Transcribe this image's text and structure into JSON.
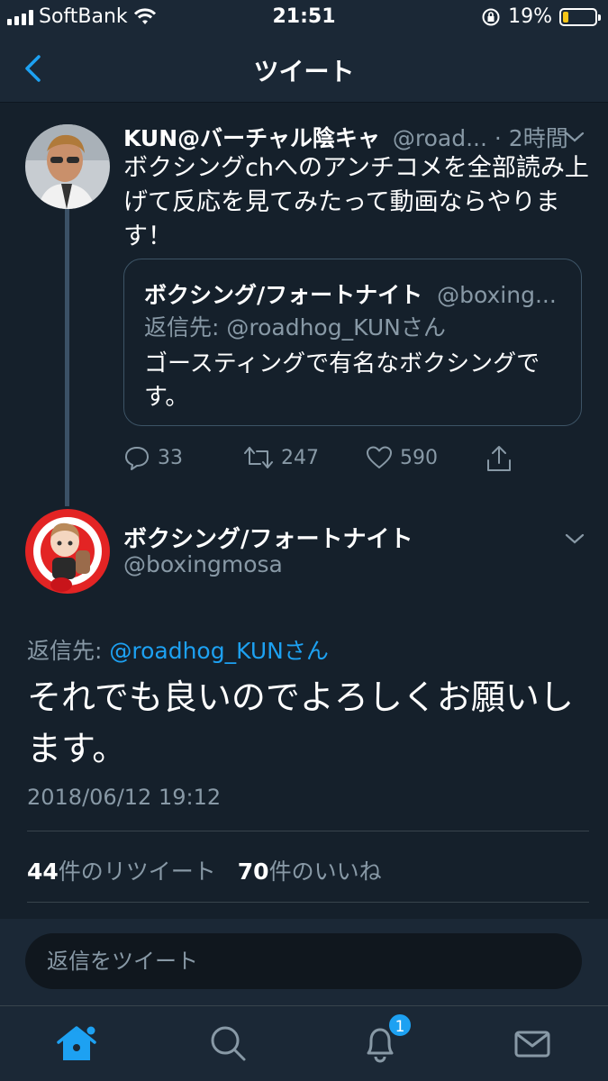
{
  "status_bar": {
    "carrier": "SoftBank",
    "time": "21:51",
    "battery_percent": "19%",
    "battery_level": 0.19,
    "icons": [
      "signal-icon",
      "wifi-icon",
      "rotation-lock-icon",
      "battery-icon"
    ]
  },
  "nav": {
    "title": "ツイート",
    "back_icon": "chevron-left-icon"
  },
  "tweet1": {
    "name": "KUN@バーチャル陰キャ",
    "handle": "@road...",
    "time": "· 2時間",
    "text": "ボクシングchへのアンチコメを全部読み上げて反応を見てみたって動画ならやります！",
    "quote": {
      "name": "ボクシング/フォートナイト",
      "handle": "@boxing...",
      "reply_to": "返信先: @roadhog_KUNさん",
      "text": "ゴースティングで有名なボクシングです。"
    },
    "actions": {
      "replies": "33",
      "retweets": "247",
      "likes": "590"
    }
  },
  "tweet2": {
    "name": "ボクシング/フォートナイト",
    "handle": "@boxingmosa",
    "reply_prefix": "返信先: ",
    "reply_user": "@roadhog_KUNさん",
    "text": "それでも良いのでよろしくお願いします。",
    "date": "2018/06/12 19:12",
    "retweet_count": "44",
    "retweet_label": "件のリツイート",
    "like_count": "70",
    "like_label": "件のいいね"
  },
  "reply_input": {
    "placeholder": "返信をツイート"
  },
  "tabs": {
    "items": [
      "home-icon",
      "search-icon",
      "notifications-icon",
      "messages-icon"
    ],
    "notification_badge": "1"
  },
  "colors": {
    "background": "#15202b",
    "bar": "#1b2836",
    "accent": "#1da1f2",
    "muted": "#8899a6"
  }
}
